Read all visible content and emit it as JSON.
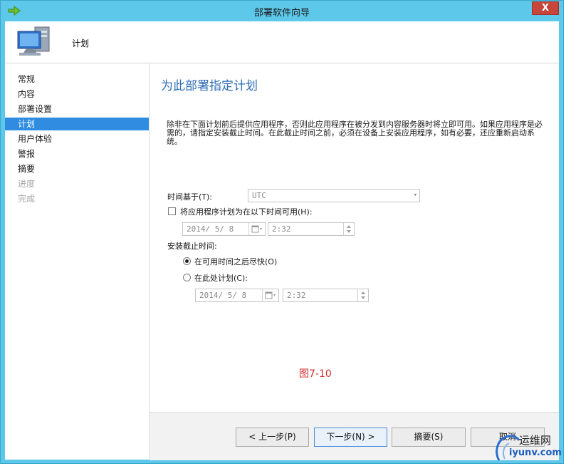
{
  "window": {
    "title": "部署软件向导",
    "close_glyph": "X"
  },
  "header": {
    "title": "计划"
  },
  "sidebar": {
    "items": [
      {
        "label": "常规",
        "state": "normal"
      },
      {
        "label": "内容",
        "state": "normal"
      },
      {
        "label": "部署设置",
        "state": "normal"
      },
      {
        "label": "计划",
        "state": "active"
      },
      {
        "label": "用户体验",
        "state": "normal"
      },
      {
        "label": "警报",
        "state": "normal"
      },
      {
        "label": "摘要",
        "state": "normal"
      },
      {
        "label": "进度",
        "state": "disabled"
      },
      {
        "label": "完成",
        "state": "disabled"
      }
    ]
  },
  "main": {
    "title": "为此部署指定计划",
    "description": "除非在下面计划前后提供应用程序，否则此应用程序在被分发到内容服务器时将立即可用。如果应用程序是必需的，请指定安装截止时间。在此截止时间之前，必须在设备上安装应用程序，如有必要，还应重新启动系统。",
    "time_based_label": "时间基于(T):",
    "time_based_value": "UTC",
    "available_checkbox_label": "将应用程序计划为在以下时间可用(H):",
    "available_date": "2014/ 5/ 8",
    "available_time": "2:32",
    "deadline_label": "安装截止时间:",
    "radio_asap_label": "在可用时间之后尽快(O)",
    "radio_schedule_label": "在此处计划(C):",
    "deadline_date": "2014/ 5/ 8",
    "deadline_time": "2:32",
    "figure_caption": "图7-10"
  },
  "footer": {
    "prev_label": "< 上一步(P)",
    "next_label": "下一步(N) >",
    "summary_label": "摘要(S)",
    "cancel_label": "取消"
  },
  "watermark": {
    "text_cn": "运维网",
    "text_url": "iyunv.com"
  },
  "colors": {
    "title_bar": "#5ec8ea",
    "nav_active": "#2f8ce0",
    "page_title": "#2d6db5",
    "caption": "#d22d2d"
  }
}
